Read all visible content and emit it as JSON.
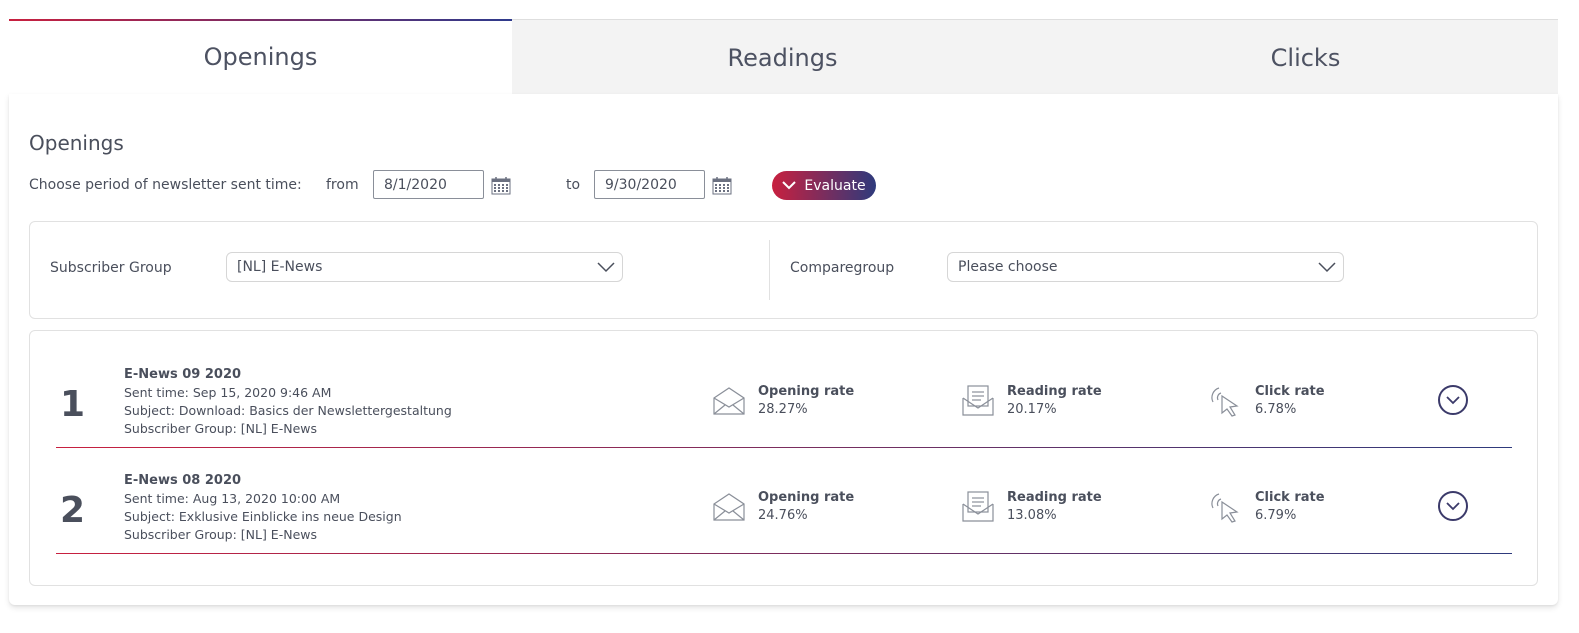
{
  "tabs": [
    {
      "label": "Openings",
      "active": true
    },
    {
      "label": "Readings",
      "active": false
    },
    {
      "label": "Clicks",
      "active": false
    }
  ],
  "panel": {
    "title": "Openings",
    "period_label": "Choose period of newsletter sent time:",
    "from_label": "from",
    "from_value": "8/1/2020",
    "to_label": "to",
    "to_value": "9/30/2020",
    "evaluate_label": "Evaluate"
  },
  "filters": {
    "subscriber_group_label": "Subscriber Group",
    "subscriber_group_value": "[NL] E-News",
    "comparegroup_label": "Comparegroup",
    "comparegroup_value": "Please choose"
  },
  "newsletters": [
    {
      "rank": "1",
      "title": "E-News 09 2020",
      "sent_time": "Sent time: Sep 15, 2020 9:46 AM",
      "subject": "Subject: Download: Basics der Newslettergestaltung",
      "group": "Subscriber Group: [NL] E-News",
      "opening_label": "Opening rate",
      "opening_value": "28.27%",
      "reading_label": "Reading rate",
      "reading_value": "20.17%",
      "click_label": "Click rate",
      "click_value": "6.78%"
    },
    {
      "rank": "2",
      "title": "E-News 08 2020",
      "sent_time": "Sent time: Aug 13, 2020 10:00 AM",
      "subject": "Subject: Exklusive Einblicke ins neue Design",
      "group": "Subscriber Group: [NL] E-News",
      "opening_label": "Opening rate",
      "opening_value": "24.76%",
      "reading_label": "Reading rate",
      "reading_value": "13.08%",
      "click_label": "Click rate",
      "click_value": "6.79%"
    }
  ],
  "colors": {
    "accent_red": "#c8203f",
    "accent_navy": "#2e3a7c",
    "text": "#4a4f5c"
  },
  "icons": [
    "calendar-icon",
    "chevron-down-icon",
    "envelope-icon",
    "document-envelope-icon",
    "cursor-click-icon"
  ]
}
